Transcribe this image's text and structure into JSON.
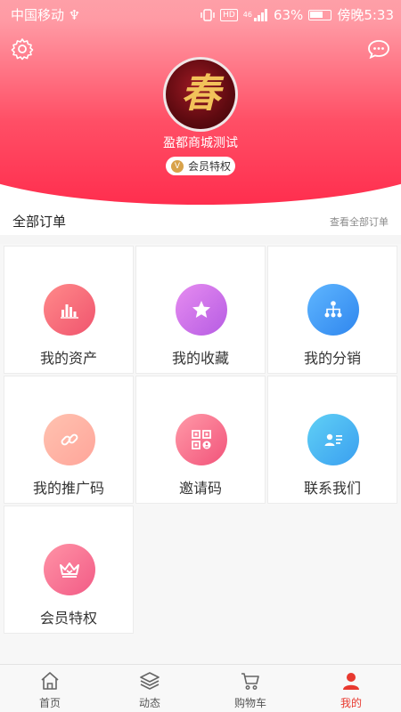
{
  "status_bar": {
    "carrier": "中国移动 ♆",
    "signal": "46",
    "hd": "HD",
    "battery": "63%",
    "time": "傍晚5:33"
  },
  "profile": {
    "username": "盈都商城测试",
    "vip_label": "会员特权",
    "vip_icon_letter": "V",
    "avatar_glyph": "春"
  },
  "orders": {
    "title": "全部订单",
    "view_all": "查看全部订单"
  },
  "grid": [
    {
      "label": "我的资产",
      "icon": "bars-icon",
      "color_from": "#ff8a8a",
      "color_to": "#f0546e"
    },
    {
      "label": "我的收藏",
      "icon": "star-icon",
      "color_from": "#e68cf0",
      "color_to": "#b65ce3"
    },
    {
      "label": "我的分销",
      "icon": "network-icon",
      "color_from": "#5fb6ff",
      "color_to": "#2f86ee"
    },
    {
      "label": "我的推广码",
      "icon": "link-icon",
      "color_from": "#ffc2b0",
      "color_to": "#ffa59a"
    },
    {
      "label": "邀请码",
      "icon": "qr-icon",
      "color_from": "#ff9aa8",
      "color_to": "#f2537a"
    },
    {
      "label": "联系我们",
      "icon": "contact-card-icon",
      "color_from": "#60d0f5",
      "color_to": "#3a9ff0"
    },
    {
      "label": "会员特权",
      "icon": "crown-icon",
      "color_from": "#ff93a6",
      "color_to": "#f25b86"
    }
  ],
  "tabs": [
    {
      "label": "首页",
      "icon": "home-icon",
      "active": false
    },
    {
      "label": "动态",
      "icon": "layers-icon",
      "active": false
    },
    {
      "label": "购物车",
      "icon": "cart-icon",
      "active": false
    },
    {
      "label": "我的",
      "icon": "user-icon",
      "active": true
    }
  ],
  "colors": {
    "accent": "#e8392f",
    "header_top": "#fb5a64",
    "header_bottom": "#ff2e4e"
  }
}
